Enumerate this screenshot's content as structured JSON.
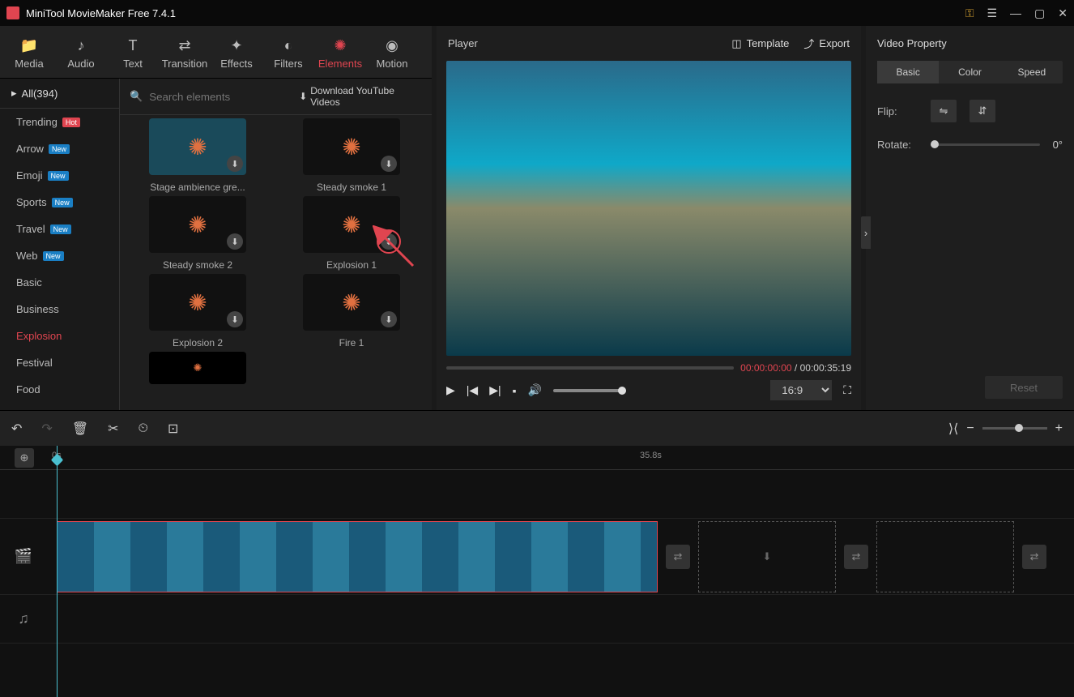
{
  "app": {
    "title": "MiniTool MovieMaker Free 7.4.1"
  },
  "tabs": [
    {
      "label": "Media",
      "icon": "📁"
    },
    {
      "label": "Audio",
      "icon": "♪"
    },
    {
      "label": "Text",
      "icon": "T"
    },
    {
      "label": "Transition",
      "icon": "⇄"
    },
    {
      "label": "Effects",
      "icon": "✦"
    },
    {
      "label": "Filters",
      "icon": "◐"
    },
    {
      "label": "Elements",
      "icon": "✺",
      "active": true
    },
    {
      "label": "Motion",
      "icon": "◉"
    }
  ],
  "categories": {
    "header": "All(394)",
    "items": [
      {
        "label": "Trending",
        "badge": "Hot",
        "badgeClass": "badge-hot"
      },
      {
        "label": "Arrow",
        "badge": "New",
        "badgeClass": "badge-new"
      },
      {
        "label": "Emoji",
        "badge": "New",
        "badgeClass": "badge-new"
      },
      {
        "label": "Sports",
        "badge": "New",
        "badgeClass": "badge-new"
      },
      {
        "label": "Travel",
        "badge": "New",
        "badgeClass": "badge-new"
      },
      {
        "label": "Web",
        "badge": "New",
        "badgeClass": "badge-new"
      },
      {
        "label": "Basic"
      },
      {
        "label": "Business"
      },
      {
        "label": "Explosion",
        "active": true
      },
      {
        "label": "Festival"
      },
      {
        "label": "Food"
      }
    ]
  },
  "search": {
    "placeholder": "Search elements",
    "downloadLink": "Download YouTube Videos"
  },
  "elements": [
    {
      "label": "Stage ambience gre...",
      "color": "#1a4a5a"
    },
    {
      "label": "Steady smoke 1",
      "color": "#111"
    },
    {
      "label": "Steady smoke 2",
      "color": "#111"
    },
    {
      "label": "Explosion 1",
      "color": "#111",
      "highlight": true
    },
    {
      "label": "Explosion 2",
      "color": "#111"
    },
    {
      "label": "Fire 1",
      "color": "#111"
    }
  ],
  "player": {
    "title": "Player",
    "template": "Template",
    "export": "Export",
    "currentTime": "00:00:00:00",
    "sep": " / ",
    "totalTime": "00:00:35:19",
    "aspect": "16:9"
  },
  "props": {
    "title": "Video Property",
    "tabs": [
      "Basic",
      "Color",
      "Speed"
    ],
    "flipLabel": "Flip:",
    "rotateLabel": "Rotate:",
    "rotateValue": "0°",
    "reset": "Reset"
  },
  "timeline": {
    "start": "0s",
    "end": "35.8s"
  }
}
